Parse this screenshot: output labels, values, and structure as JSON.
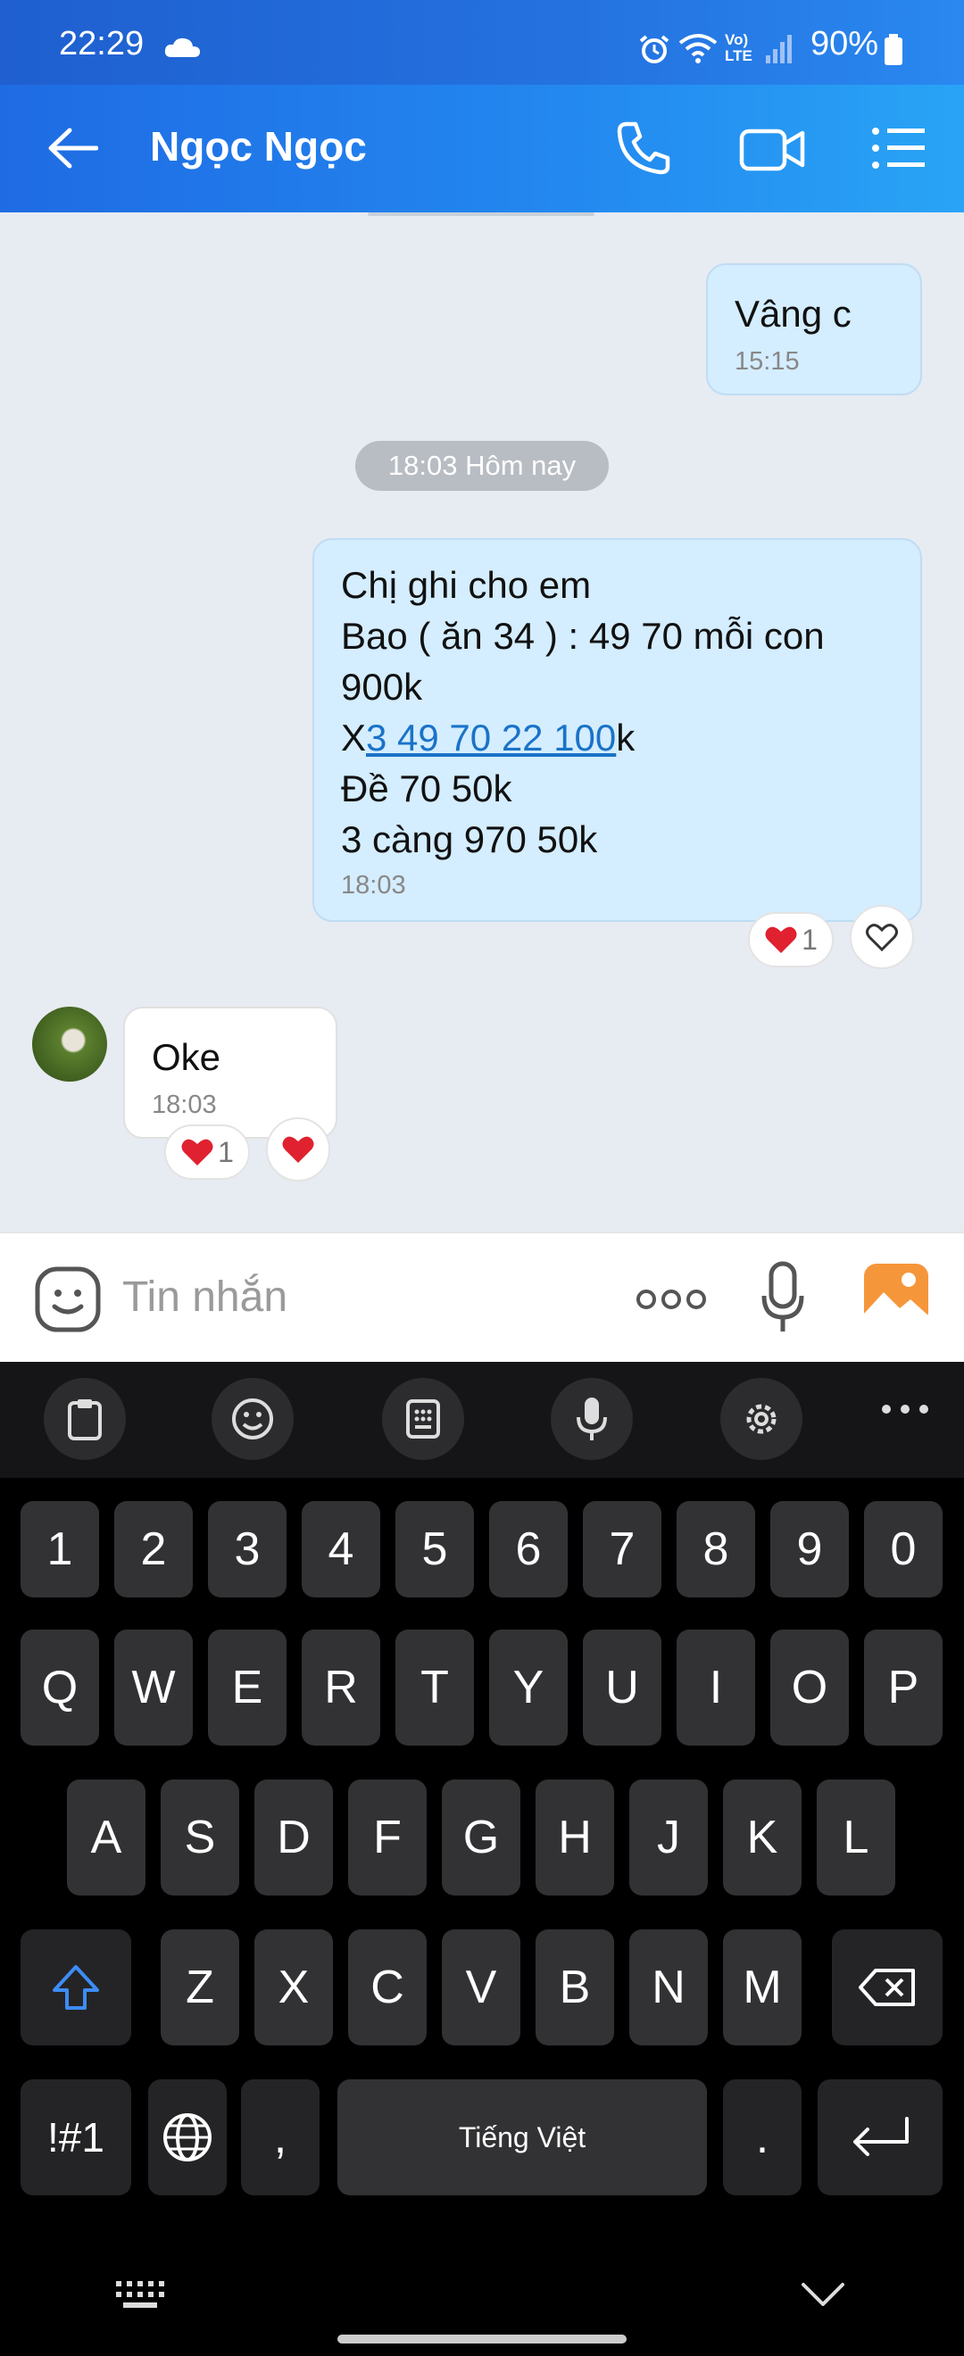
{
  "status_bar": {
    "time": "22:29",
    "battery": "90%",
    "lte": "Vo) LTE"
  },
  "header": {
    "contact_name": "Ngọc Ngọc"
  },
  "messages": {
    "m1": {
      "text": "Vâng c",
      "time": "15:15"
    },
    "date_separator": "18:03 Hôm nay",
    "m2": {
      "line1": "Chị ghi cho em",
      "line2": "Bao ( ăn 34 ) : 49 70 mỗi con",
      "line3": "900k",
      "line4_prefix": "X",
      "line4_link": "3 49 70 22 100",
      "line4_suffix": "k",
      "line5": "Đề 70 50k",
      "line6": "3 càng 970 50k",
      "time": "18:03",
      "reaction_count": "1"
    },
    "m3": {
      "text": "Oke",
      "time": "18:03",
      "reaction_count": "1"
    }
  },
  "input": {
    "placeholder": "Tin nhắn"
  },
  "keyboard": {
    "numbers": [
      "1",
      "2",
      "3",
      "4",
      "5",
      "6",
      "7",
      "8",
      "9",
      "0"
    ],
    "row1": [
      "Q",
      "W",
      "E",
      "R",
      "T",
      "Y",
      "U",
      "I",
      "O",
      "P"
    ],
    "row2": [
      "A",
      "S",
      "D",
      "F",
      "G",
      "H",
      "J",
      "K",
      "L"
    ],
    "row3": [
      "Z",
      "X",
      "C",
      "V",
      "B",
      "N",
      "M"
    ],
    "symbols": "!#1",
    "comma": ",",
    "space": "Tiếng Việt",
    "period": "."
  },
  "colors": {
    "header": "#2389f0",
    "outgoing_bubble": "#d4edff",
    "link": "#1a73c8",
    "heart": "#e0212f"
  }
}
